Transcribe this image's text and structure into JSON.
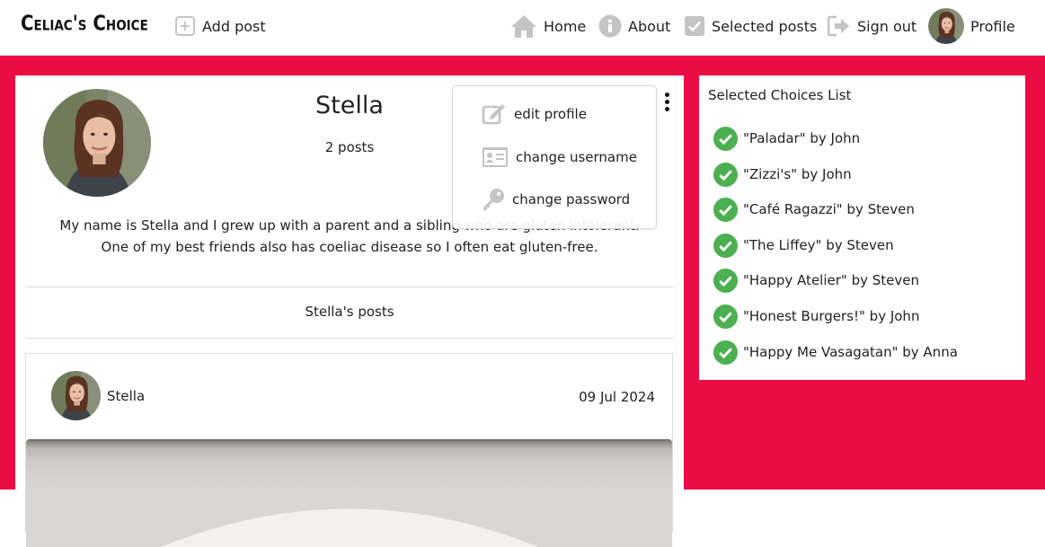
{
  "nav": {
    "brand": "Celiac's Choice",
    "add_post": "Add post",
    "home": "Home",
    "about": "About",
    "selected_posts": "Selected posts",
    "sign_out": "Sign out",
    "profile": "Profile"
  },
  "colors": {
    "accent": "#ec0c45",
    "check": "#4caf50",
    "icon_gray": "#c4c4c4"
  },
  "profile": {
    "name": "Stella",
    "posts_count": "2 posts",
    "bio_line1": "My name is Stella and I grew up with a parent and a sibling who are gluten intolerant.",
    "bio_line2": "One of my best friends also has coeliac disease so I often eat gluten-free.",
    "posts_heading": "Stella's posts"
  },
  "dropdown": {
    "edit_profile": "edit profile",
    "change_username": "change username",
    "change_password": "change password"
  },
  "post": {
    "author": "Stella",
    "date": "09 Jul 2024"
  },
  "choices": {
    "title": "Selected Choices List",
    "items": [
      "\"Paladar\" by John",
      "\"Zizzi's\" by John",
      "\"Café Ragazzi\" by Steven",
      "\"The Liffey\" by Steven",
      "\"Happy Atelier\" by Steven",
      "\"Honest Burgers!\" by John",
      "\"Happy Me Vasagatan\" by Anna"
    ]
  },
  "icons": [
    "plus-square-icon",
    "home-icon",
    "info-icon",
    "check-square-icon",
    "sign-out-icon",
    "edit-icon",
    "id-card-icon",
    "key-icon",
    "check-circle-icon",
    "kebab-menu-icon"
  ]
}
